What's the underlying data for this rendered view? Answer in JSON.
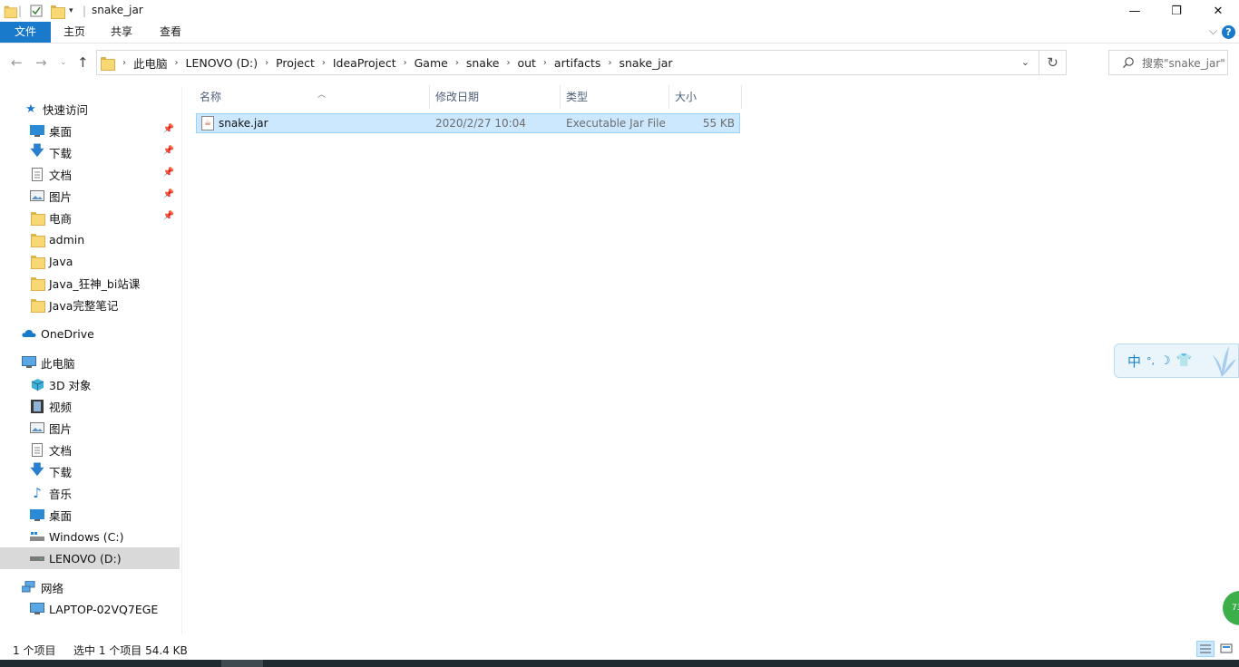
{
  "window": {
    "title": "snake_jar",
    "controls": {
      "minimize": "—",
      "maximize": "❐",
      "close": "✕"
    }
  },
  "ribbon": {
    "tabs": [
      "文件",
      "主页",
      "共享",
      "查看"
    ],
    "help": "?"
  },
  "address": {
    "breadcrumbs": [
      "此电脑",
      "LENOVO (D:)",
      "Project",
      "IdeaProject",
      "Game",
      "snake",
      "out",
      "artifacts",
      "snake_jar"
    ]
  },
  "search": {
    "placeholder": "搜索\"snake_jar\""
  },
  "nav": {
    "quick_access": "快速访问",
    "quick_items": [
      {
        "label": "桌面",
        "pinned": true
      },
      {
        "label": "下载",
        "pinned": true
      },
      {
        "label": "文档",
        "pinned": true
      },
      {
        "label": "图片",
        "pinned": true
      },
      {
        "label": "电商",
        "pinned": true
      },
      {
        "label": "admin",
        "pinned": false
      },
      {
        "label": "Java",
        "pinned": false
      },
      {
        "label": "Java_狂神_bi站课",
        "pinned": false
      },
      {
        "label": "Java完整笔记",
        "pinned": false
      }
    ],
    "onedrive": "OneDrive",
    "this_pc": "此电脑",
    "pc_items": [
      "3D 对象",
      "视频",
      "图片",
      "文档",
      "下载",
      "音乐",
      "桌面",
      "Windows (C:)",
      "LENOVO (D:)"
    ],
    "selected": "LENOVO (D:)",
    "network": "网络",
    "network_items": [
      "LAPTOP-02VQ7EGE"
    ]
  },
  "columns": {
    "name": "名称",
    "modified": "修改日期",
    "type": "类型",
    "size": "大小"
  },
  "files": [
    {
      "name": "snake.jar",
      "modified": "2020/2/27 10:04",
      "type": "Executable Jar File",
      "size": "55 KB",
      "selected": true
    }
  ],
  "ime": {
    "mode": "中"
  },
  "status": {
    "count": "1 个项目",
    "selection": "选中 1 个项目  54.4 KB"
  },
  "colors": {
    "accent": "#1979ca",
    "selection_bg": "#cce8ff",
    "selection_border": "#99d1ff"
  }
}
